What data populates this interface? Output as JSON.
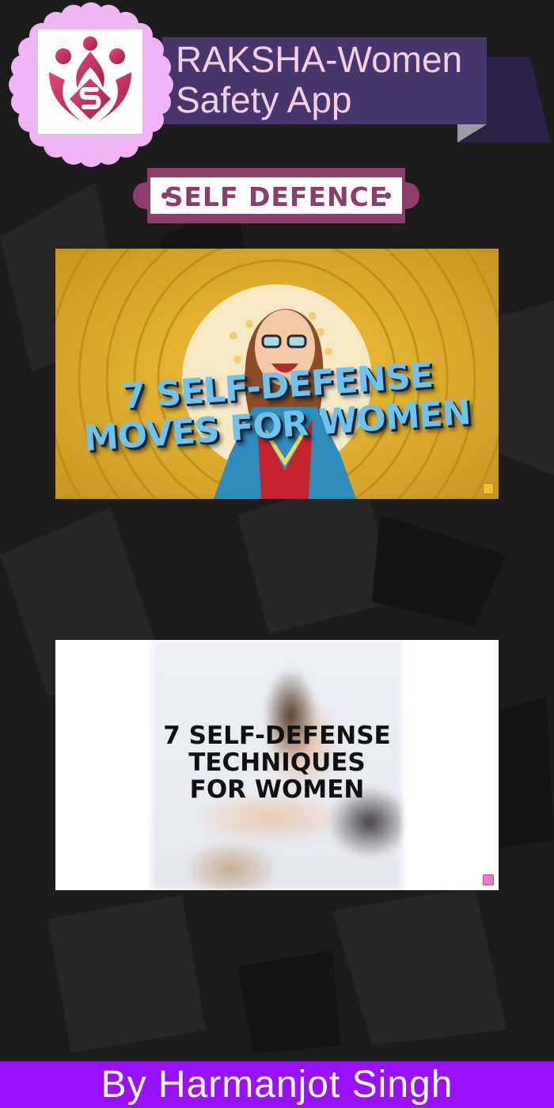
{
  "header": {
    "title_line1": "RAKSHA-Women",
    "title_line2": "Safety App",
    "logo_icon": "raksha-logo-icon"
  },
  "section": {
    "label": "SELF DEFENCE"
  },
  "videos": [
    {
      "thumbnail_line1": "7 SELF-DEFENSE",
      "thumbnail_line2": "MOVES FOR WOMEN"
    },
    {
      "thumbnail_line1": "7 SELF-DEFENSE",
      "thumbnail_line2": "TECHNIQUES",
      "thumbnail_line3": "FOR WOMEN"
    }
  ],
  "footer": {
    "credit": "By Harmanjot Singh"
  },
  "colors": {
    "background": "#1c1c1c",
    "badge": "#f0b3f3",
    "title_box": "#46366b",
    "title_text": "#f4cfe4",
    "label_frame": "#8e3d6b",
    "footer": "#9810fc"
  }
}
